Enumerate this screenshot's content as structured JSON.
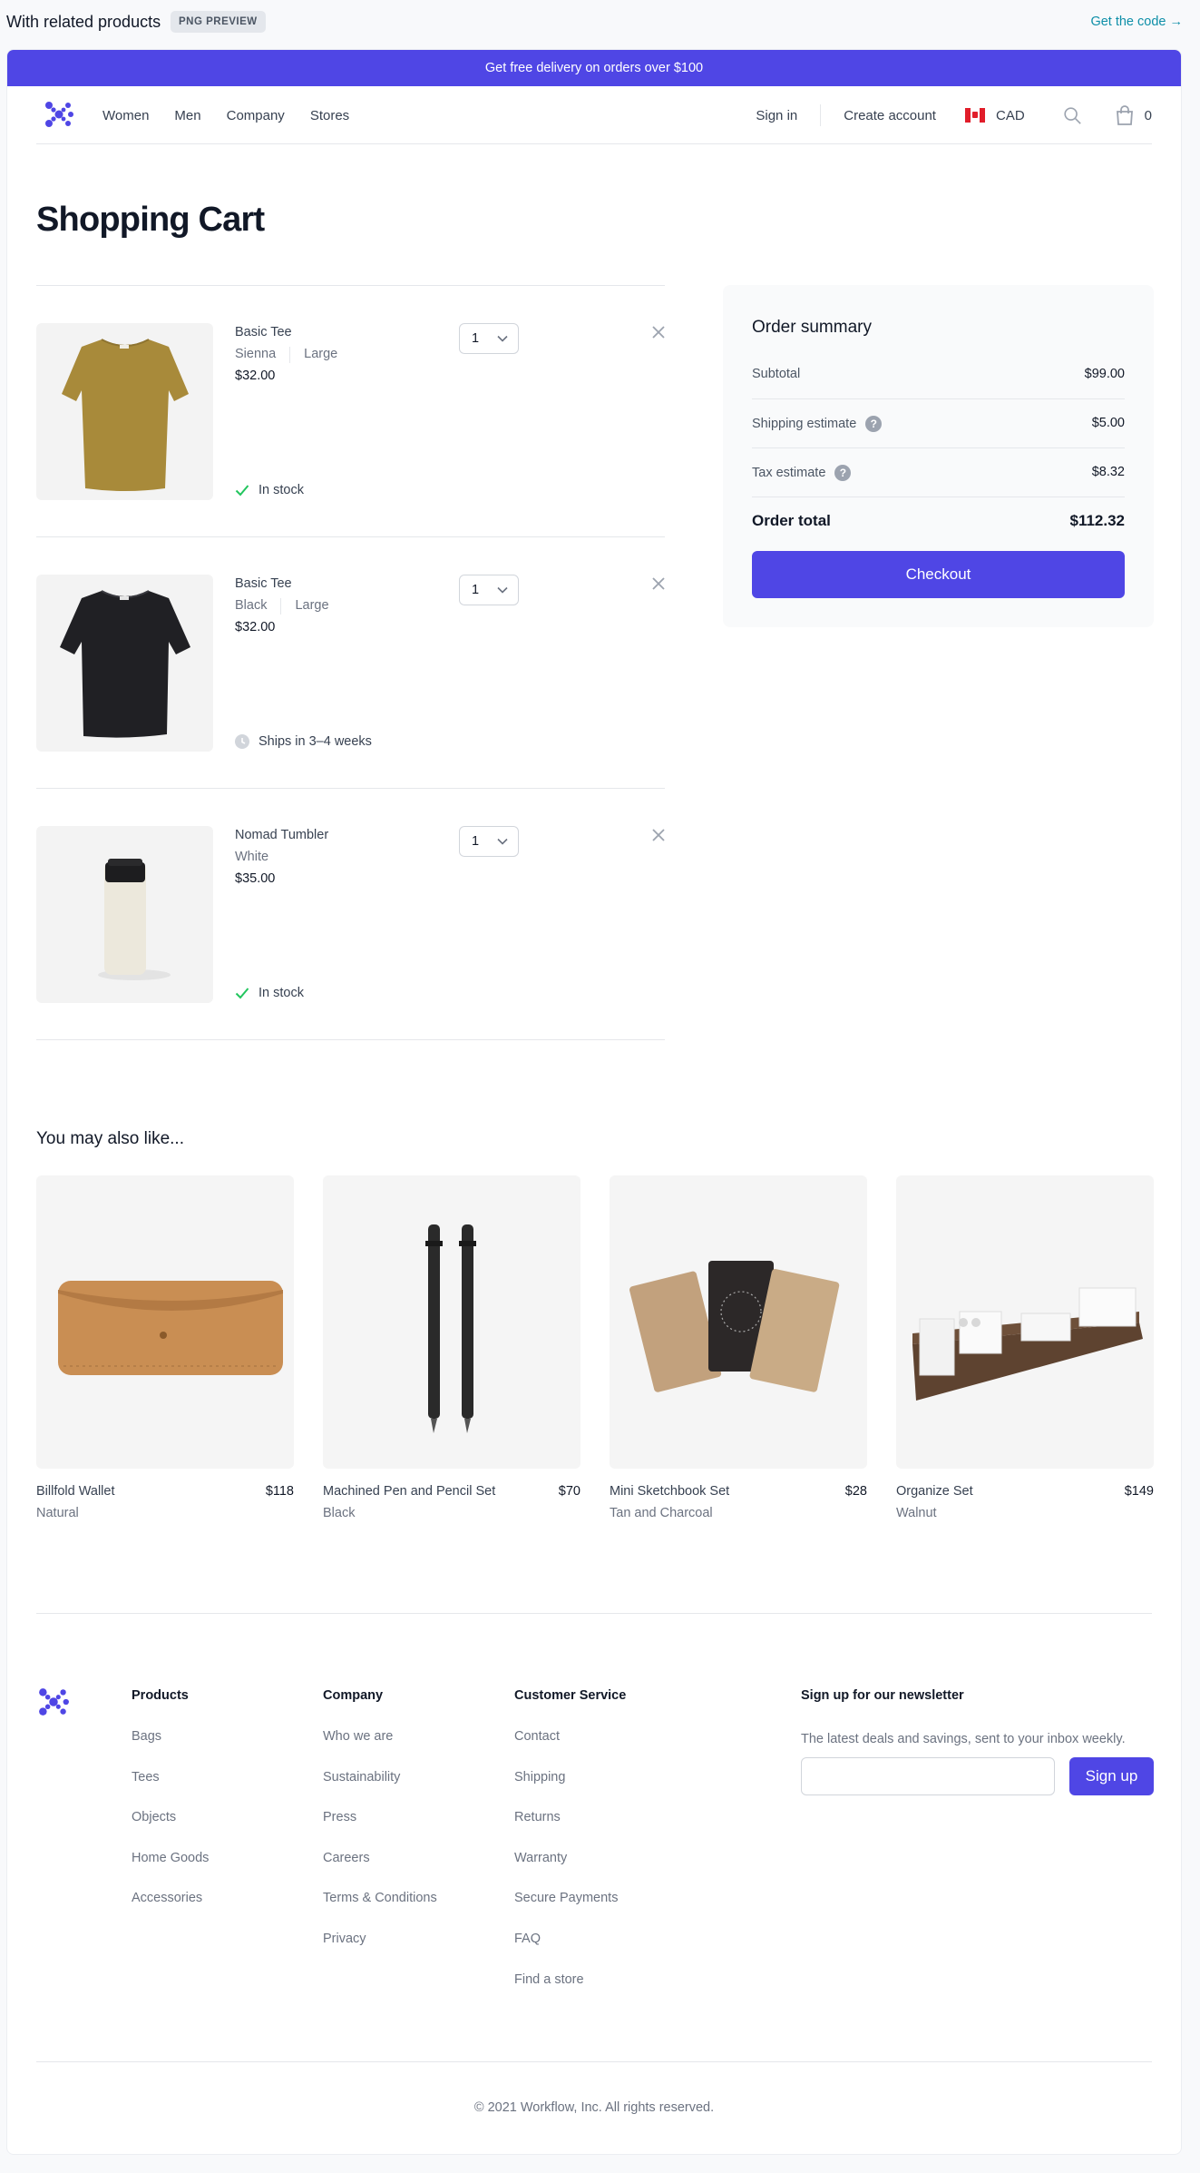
{
  "header": {
    "title": "With related products",
    "badge": "PNG PREVIEW",
    "code_link": "Get the code →"
  },
  "promo": "Get free delivery on orders over $100",
  "nav": {
    "links": [
      "Women",
      "Men",
      "Company",
      "Stores"
    ],
    "sign_in": "Sign in",
    "create_account": "Create account",
    "currency": "CAD",
    "cart_count": "0"
  },
  "page_title": "Shopping Cart",
  "cart": [
    {
      "name": "Basic Tee",
      "color": "Sienna",
      "size": "Large",
      "price": "$32.00",
      "qty": "1",
      "status": "In stock",
      "status_type": "in-stock"
    },
    {
      "name": "Basic Tee",
      "color": "Black",
      "size": "Large",
      "price": "$32.00",
      "qty": "1",
      "status": "Ships in 3–4 weeks",
      "status_type": "clock"
    },
    {
      "name": "Nomad Tumbler",
      "color": "White",
      "size": "",
      "price": "$35.00",
      "qty": "1",
      "status": "In stock",
      "status_type": "in-stock"
    }
  ],
  "summary": {
    "title": "Order summary",
    "subtotal_label": "Subtotal",
    "subtotal": "$99.00",
    "shipping_label": "Shipping estimate",
    "shipping": "$5.00",
    "tax_label": "Tax estimate",
    "tax": "$8.32",
    "total_label": "Order total",
    "total": "$112.32",
    "help_glyph": "?",
    "checkout": "Checkout"
  },
  "related": {
    "title": "You may also like...",
    "items": [
      {
        "name": "Billfold Wallet",
        "price": "$118",
        "color": "Natural"
      },
      {
        "name": "Machined Pen and Pencil Set",
        "price": "$70",
        "color": "Black"
      },
      {
        "name": "Mini Sketchbook Set",
        "price": "$28",
        "color": "Tan and Charcoal"
      },
      {
        "name": "Organize Set",
        "price": "$149",
        "color": "Walnut"
      }
    ]
  },
  "footer": {
    "products": {
      "title": "Products",
      "links": [
        "Bags",
        "Tees",
        "Objects",
        "Home Goods",
        "Accessories"
      ]
    },
    "company": {
      "title": "Company",
      "links": [
        "Who we are",
        "Sustainability",
        "Press",
        "Careers",
        "Terms & Conditions",
        "Privacy"
      ]
    },
    "service": {
      "title": "Customer Service",
      "links": [
        "Contact",
        "Shipping",
        "Returns",
        "Warranty",
        "Secure Payments",
        "FAQ",
        "Find a store"
      ]
    },
    "newsletter": {
      "title": "Sign up for our newsletter",
      "desc": "The latest deals and savings, sent to your inbox weekly.",
      "button": "Sign up"
    },
    "copyright": "© 2021 Workflow, Inc. All rights reserved."
  },
  "colors": {
    "brand": "#4f46e5",
    "success": "#22c55e"
  }
}
